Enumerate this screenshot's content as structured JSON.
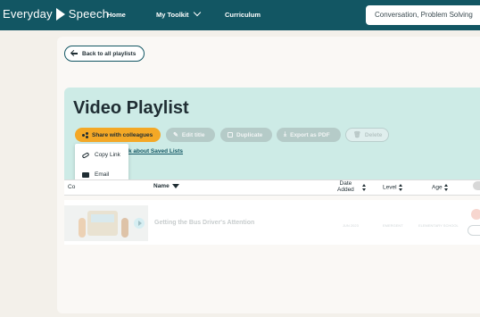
{
  "nav": {
    "logo_left": "Everyday",
    "logo_right": "Speech",
    "home": "Home",
    "toolkit": "My Toolkit",
    "curriculum": "Curriculum",
    "search_placeholder": "Conversation, Problem Solving"
  },
  "page": {
    "back_label": "Back to all playlists",
    "title": "Video Playlist"
  },
  "actions": {
    "share": "Share with colleagues",
    "edit": "Edit title",
    "duplicate": "Duplicate",
    "export": "Export as PDF",
    "delete": "Delete"
  },
  "share_menu": {
    "copy_link": "Copy Link",
    "email": "Email"
  },
  "saved_lists_link": "k about Saved Lists",
  "table": {
    "headers": {
      "col_cut": "Co",
      "name": "Name",
      "date_line1": "Date",
      "date_line2": "Added",
      "level": "Level",
      "age": "Age"
    },
    "row": {
      "name": "Getting the Bus Driver's Attention",
      "date": "JUN 2023",
      "level": "EMERGENT",
      "age": "ELEMENTARY SCHOOL"
    }
  },
  "colors": {
    "nav_bg": "#125663",
    "accent": "#f4a826",
    "hero_bg": "#cdebe6"
  }
}
